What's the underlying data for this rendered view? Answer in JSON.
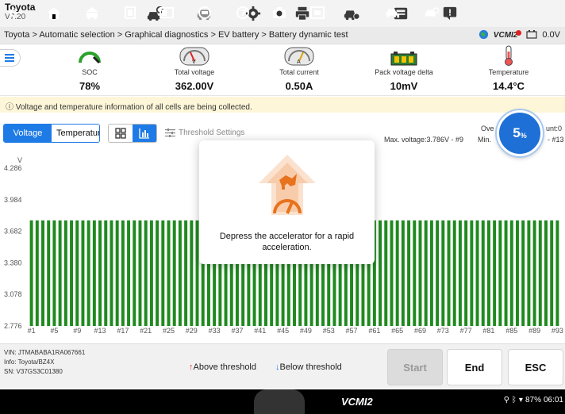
{
  "app": {
    "make": "Toyota",
    "version": "V7.20"
  },
  "top_icons": [
    "car-diagnose-icon",
    "car-icon",
    "gear-icon",
    "printer-icon",
    "car-settings-icon",
    "inbox-icon",
    "feedback-icon"
  ],
  "breadcrumb": "Toyota > Automatic selection > Graphical diagnostics > EV battery > Battery dynamic test",
  "connection": {
    "vci": "VCMI2",
    "voltage": "0.0V"
  },
  "metrics": [
    {
      "label": "SOC",
      "value": "78%",
      "icon": "soc-gauge-icon"
    },
    {
      "label": "Total voltage",
      "value": "362.00V",
      "icon": "voltmeter-icon"
    },
    {
      "label": "Total current",
      "value": "0.50A",
      "icon": "ammeter-icon"
    },
    {
      "label": "Pack voltage delta",
      "value": "10mV",
      "icon": "battery-pack-icon"
    },
    {
      "label": "Temperature",
      "value": "14.4°C",
      "icon": "thermometer-icon"
    }
  ],
  "info": "Voltage and temperature information of all cells are being collected.",
  "tabs": {
    "voltage": "Voltage",
    "temperature": "Temperature"
  },
  "threshold_settings": "Threshold Settings",
  "stats": {
    "max": "Max. voltage:3.786V - #9",
    "over_prefix": "Ove",
    "min_prefix": "Min.",
    "count_suffix": "unt:0",
    "min_suffix": "- #13"
  },
  "progress": {
    "value": "5",
    "unit": "%"
  },
  "modal": {
    "message": "Depress the accelerator for a rapid acceleration."
  },
  "chart_data": {
    "type": "bar",
    "ylabel": "V",
    "yticks": [
      "4.286",
      "3.984",
      "3.682",
      "3.380",
      "3.078",
      "2.776"
    ],
    "ylim": [
      2.776,
      4.286
    ],
    "count": 93,
    "value": 3.786,
    "xticks": [
      "#1",
      "#5",
      "#9",
      "#13",
      "#17",
      "#21",
      "#25",
      "#29",
      "#33",
      "#37",
      "#41",
      "#45",
      "#49",
      "#53",
      "#57",
      "#61",
      "#65",
      "#69",
      "#73",
      "#77",
      "#81",
      "#85",
      "#89",
      "#93"
    ],
    "color": "#1f8a1f"
  },
  "vehicle": {
    "vin": "VIN: JTMABABA1RA067661",
    "info": "Info: Toyota/BZ4X",
    "sn": "SN: V37GS3C01380"
  },
  "legend": {
    "above": "Above threshold",
    "below": "Below threshold"
  },
  "buttons": {
    "start": "Start",
    "end": "End",
    "esc": "ESC"
  },
  "statusbar": {
    "battery": "87%",
    "time": "06:01"
  }
}
